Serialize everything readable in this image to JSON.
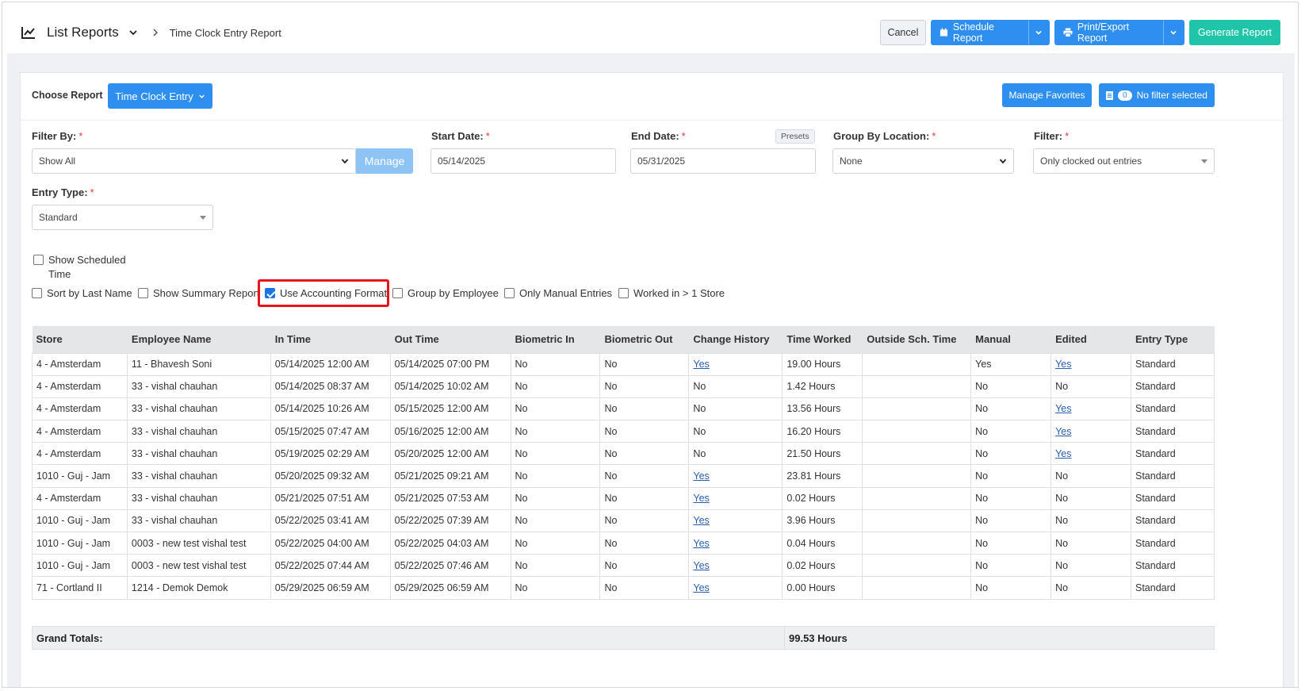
{
  "breadcrumb": {
    "section": "List Reports",
    "current": "Time Clock Entry Report"
  },
  "toolbar": {
    "cancel": "Cancel",
    "schedule": "Schedule Report",
    "print_export": "Print/Export Report",
    "generate": "Generate Report"
  },
  "report_select": {
    "label": "Choose Report",
    "value": "Time Clock Entry",
    "manage_favorites": "Manage Favorites",
    "filter_count": "0",
    "filter_text": "No filter selected"
  },
  "filters": {
    "filter_by": {
      "label": "Filter By:",
      "value": "Show All",
      "manage": "Manage"
    },
    "start_date": {
      "label": "Start Date:",
      "value": "05/14/2025"
    },
    "end_date": {
      "label": "End Date:",
      "value": "05/31/2025",
      "presets": "Presets"
    },
    "group_by_location": {
      "label": "Group By Location:",
      "value": "None"
    },
    "filter": {
      "label": "Filter:",
      "value": "Only clocked out entries"
    },
    "entry_type": {
      "label": "Entry Type:",
      "value": "Standard"
    },
    "required_mark": "*"
  },
  "options": {
    "show_scheduled_time_1": "Show Scheduled",
    "show_scheduled_time_2": "Time",
    "sort_by_last_name": "Sort by Last Name",
    "show_summary_report": "Show Summary Report",
    "use_accounting_format": "Use Accounting Format",
    "group_by_employee": "Group by Employee",
    "only_manual_entries": "Only Manual Entries",
    "worked_in_gt1_store": "Worked in > 1 Store",
    "checked": {
      "use_accounting_format": true
    }
  },
  "table": {
    "headers": [
      "Store",
      "Employee Name",
      "In Time",
      "Out Time",
      "Biometric In",
      "Biometric Out",
      "Change History",
      "Time Worked",
      "Outside Sch. Time",
      "Manual",
      "Edited",
      "Entry Type"
    ],
    "rows": [
      [
        "4 - Amsterdam",
        "11 - Bhavesh Soni",
        "05/14/2025 12:00 AM",
        "05/14/2025 07:00 PM",
        "No",
        "No",
        "Yes",
        "19.00 Hours",
        "",
        "Yes",
        "Yes",
        "Standard"
      ],
      [
        "4 - Amsterdam",
        "33 - vishal chauhan",
        "05/14/2025 08:37 AM",
        "05/14/2025 10:02 AM",
        "No",
        "No",
        "No",
        "1.42 Hours",
        "",
        "No",
        "No",
        "Standard"
      ],
      [
        "4 - Amsterdam",
        "33 - vishal chauhan",
        "05/14/2025 10:26 AM",
        "05/15/2025 12:00 AM",
        "No",
        "No",
        "No",
        "13.56 Hours",
        "",
        "No",
        "Yes",
        "Standard"
      ],
      [
        "4 - Amsterdam",
        "33 - vishal chauhan",
        "05/15/2025 07:47 AM",
        "05/16/2025 12:00 AM",
        "No",
        "No",
        "No",
        "16.20 Hours",
        "",
        "No",
        "Yes",
        "Standard"
      ],
      [
        "4 - Amsterdam",
        "33 - vishal chauhan",
        "05/19/2025 02:29 AM",
        "05/20/2025 12:00 AM",
        "No",
        "No",
        "No",
        "21.50 Hours",
        "",
        "No",
        "Yes",
        "Standard"
      ],
      [
        "1010 - Guj - Jam",
        "33 - vishal chauhan",
        "05/20/2025 09:32 AM",
        "05/21/2025 09:21 AM",
        "No",
        "No",
        "Yes",
        "23.81 Hours",
        "",
        "No",
        "No",
        "Standard"
      ],
      [
        "4 - Amsterdam",
        "33 - vishal chauhan",
        "05/21/2025 07:51 AM",
        "05/21/2025 07:53 AM",
        "No",
        "No",
        "Yes",
        "0.02 Hours",
        "",
        "No",
        "No",
        "Standard"
      ],
      [
        "1010 - Guj - Jam",
        "33 - vishal chauhan",
        "05/22/2025 03:41 AM",
        "05/22/2025 07:39 AM",
        "No",
        "No",
        "Yes",
        "3.96 Hours",
        "",
        "No",
        "No",
        "Standard"
      ],
      [
        "1010 - Guj - Jam",
        "0003 - new test vishal test",
        "05/22/2025 04:00 AM",
        "05/22/2025 04:03 AM",
        "No",
        "No",
        "Yes",
        "0.04 Hours",
        "",
        "No",
        "No",
        "Standard"
      ],
      [
        "1010 - Guj - Jam",
        "0003 - new test vishal test",
        "05/22/2025 07:44 AM",
        "05/22/2025 07:46 AM",
        "No",
        "No",
        "Yes",
        "0.02 Hours",
        "",
        "No",
        "No",
        "Standard"
      ],
      [
        "71 - Cortland II",
        "1214 - Demok Demok",
        "05/29/2025 06:59 AM",
        "05/29/2025 06:59 AM",
        "No",
        "No",
        "Yes",
        "0.00 Hours",
        "",
        "No",
        "No",
        "Standard"
      ]
    ],
    "link_columns": [
      6,
      10
    ]
  },
  "totals": {
    "label": "Grand Totals:",
    "value": "99.53 Hours"
  },
  "colors": {
    "primary": "#2e8ff0",
    "success": "#1fc4a9",
    "highlight": "#e8141c",
    "link": "#2a5db0"
  }
}
